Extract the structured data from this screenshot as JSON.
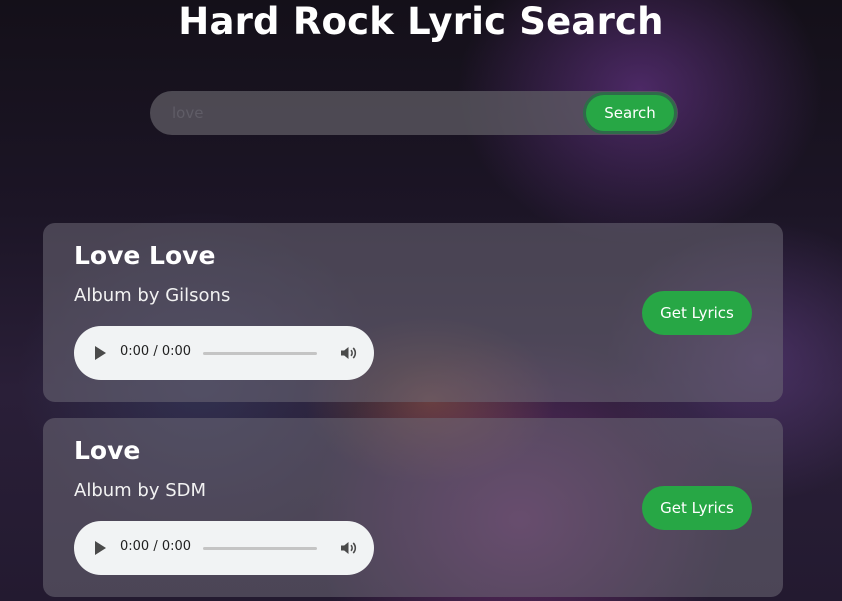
{
  "header": {
    "title": "Hard Rock Lyric Search"
  },
  "search": {
    "value": "love",
    "button_label": "Search"
  },
  "results": [
    {
      "title": "Love Love",
      "artist_line": "Album by Gilsons",
      "player": {
        "time": "0:00 / 0:00"
      },
      "button_label": "Get Lyrics"
    },
    {
      "title": "Love",
      "artist_line": "Album by SDM",
      "player": {
        "time": "0:00 / 0:00"
      },
      "button_label": "Get Lyrics"
    }
  ],
  "colors": {
    "accent": "#27a745"
  },
  "icons": {
    "play": "play-icon",
    "volume": "volume-icon"
  }
}
